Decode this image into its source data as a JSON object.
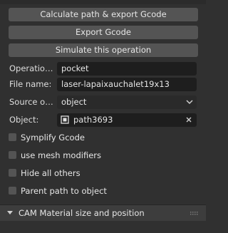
{
  "buttons": {
    "calc_export": "Calculate path & export Gcode",
    "export": "Export Gcode",
    "simulate": "Simulate this operation"
  },
  "operation": {
    "label": "Operation ...",
    "value": "pocket"
  },
  "file": {
    "label": "File name:",
    "value": "laser-lapaixauchalet19x13"
  },
  "source": {
    "label": "Source of d...",
    "value": "object"
  },
  "object": {
    "label": "Object:",
    "value": "path3693"
  },
  "checkboxes": [
    {
      "label": "Symplify Gcode",
      "checked": false
    },
    {
      "label": "use mesh modifiers",
      "checked": false
    },
    {
      "label": "Hide all others",
      "checked": false
    },
    {
      "label": "Parent path to object",
      "checked": false
    }
  ],
  "section": {
    "title": "CAM Material size and position",
    "collapsed": true
  },
  "colors": {
    "background": "#303030",
    "button": "#545454",
    "field": "#1e1e1e"
  }
}
